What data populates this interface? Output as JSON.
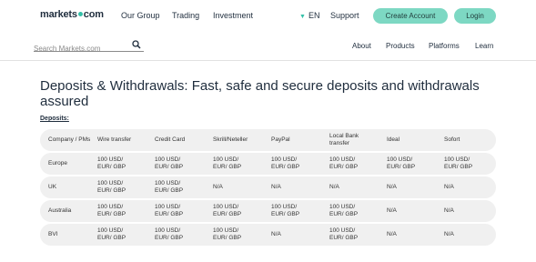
{
  "header": {
    "logo_left": "markets",
    "logo_right": "com",
    "nav": [
      "Our Group",
      "Trading",
      "Investment"
    ],
    "lang": "EN",
    "support": "Support",
    "create_account": "Create Account",
    "login": "Login"
  },
  "search": {
    "placeholder": "Search Markets.com"
  },
  "subnav": [
    "About",
    "Products",
    "Platforms",
    "Learn"
  ],
  "page": {
    "title": "Deposits & Withdrawals: Fast, safe and secure deposits and withdrawals assured",
    "section_label": "Deposits:"
  },
  "table": {
    "headers": [
      "Company / PMs",
      "Wire transfer",
      "Credit Card",
      "Skrill/Neteller",
      "PayPal",
      "Local Bank transfer",
      "Ideal",
      "Sofort"
    ],
    "rows": [
      [
        "Europe",
        "100 USD/ EUR/ GBP",
        "100 USD/ EUR/ GBP",
        "100 USD/ EUR/ GBP",
        "100 USD/ EUR/ GBP",
        "100 USD/ EUR/ GBP",
        "100 USD/ EUR/ GBP",
        "100 USD/ EUR/ GBP"
      ],
      [
        "UK",
        "100 USD/ EUR/ GBP",
        "100 USD/ EUR/ GBP",
        "N/A",
        "N/A",
        "N/A",
        "N/A",
        "N/A"
      ],
      [
        "Australia",
        "100 USD/ EUR/ GBP",
        "100 USD/ EUR/ GBP",
        "100 USD/ EUR/ GBP",
        "100 USD/ EUR/ GBP",
        "100 USD/ EUR/ GBP",
        "N/A",
        "N/A"
      ],
      [
        "BVI",
        "100 USD/ EUR/ GBP",
        "100 USD/ EUR/ GBP",
        "100 USD/ EUR/ GBP",
        "N/A",
        "100 USD/ EUR/ GBP",
        "N/A",
        "N/A"
      ]
    ]
  },
  "colors": {
    "accent": "#7dd8c3",
    "logo_dot": "#34c0a8",
    "row_bg": "#f0f0f0"
  }
}
